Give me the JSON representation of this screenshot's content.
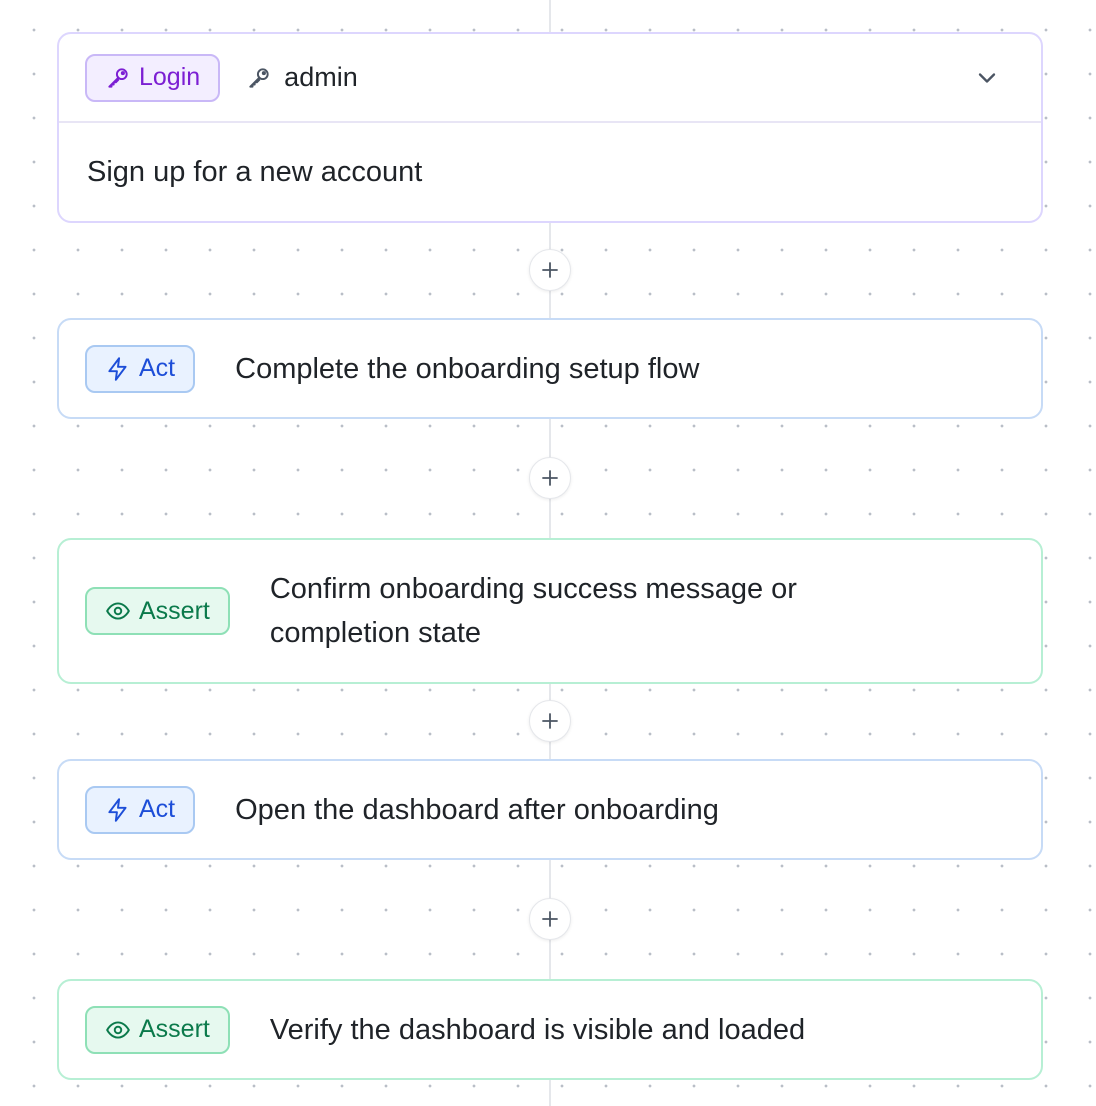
{
  "colors": {
    "login_accent": "#7c1fd3",
    "act_accent": "#1d4ed8",
    "assert_accent": "#0b7a4b"
  },
  "steps": [
    {
      "type": "login",
      "badge": "Login",
      "badge_icon": "key-icon",
      "user": "admin",
      "user_icon": "key-icon",
      "expand_icon": "chevron-down-icon",
      "text": "Sign up for a new account"
    },
    {
      "type": "act",
      "badge": "Act",
      "badge_icon": "lightning-icon",
      "text": "Complete the onboarding setup flow"
    },
    {
      "type": "assert",
      "badge": "Assert",
      "badge_icon": "eye-icon",
      "text": "Confirm onboarding success message or completion state"
    },
    {
      "type": "act",
      "badge": "Act",
      "badge_icon": "lightning-icon",
      "text": "Open the dashboard after onboarding"
    },
    {
      "type": "assert",
      "badge": "Assert",
      "badge_icon": "eye-icon",
      "text": "Verify the dashboard is visible and loaded"
    }
  ],
  "add_step_icon": "plus-icon"
}
